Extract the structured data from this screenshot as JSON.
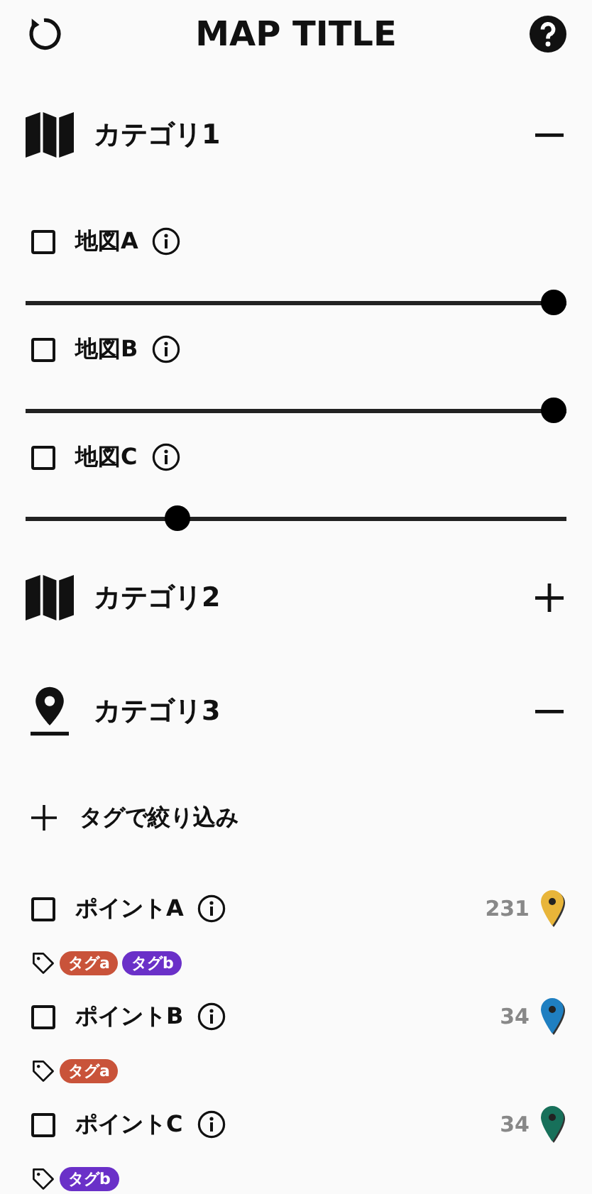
{
  "header": {
    "title": "MAP TITLE"
  },
  "categories": [
    {
      "kind": "map",
      "name": "カテゴリ1",
      "expanded": true,
      "layers": [
        {
          "name": "地図A",
          "checked": false,
          "level": 1
        },
        {
          "name": "地図B",
          "checked": false,
          "level": 1
        },
        {
          "name": "地図C",
          "checked": false,
          "level": 0.27
        }
      ]
    },
    {
      "kind": "map",
      "name": "カテゴリ2",
      "expanded": false
    },
    {
      "kind": "pin",
      "name": "カテゴリ3",
      "expanded": true,
      "filter": {
        "label": "タグで絞り込み"
      },
      "points": [
        {
          "name": "ポイントA",
          "checked": false,
          "count": "231",
          "color": "#e8b53a",
          "tags": [
            {
              "label": "タグa",
              "color": "#c9533a"
            },
            {
              "label": "タグb",
              "color": "#6a30c8"
            }
          ]
        },
        {
          "name": "ポイントB",
          "checked": false,
          "count": "34",
          "color": "#1f7fc1",
          "tags": [
            {
              "label": "タグa",
              "color": "#c9533a"
            }
          ]
        },
        {
          "name": "ポイントC",
          "checked": false,
          "count": "34",
          "color": "#17705a",
          "tags": [
            {
              "label": "タグb",
              "color": "#6a30c8"
            }
          ]
        }
      ]
    }
  ]
}
